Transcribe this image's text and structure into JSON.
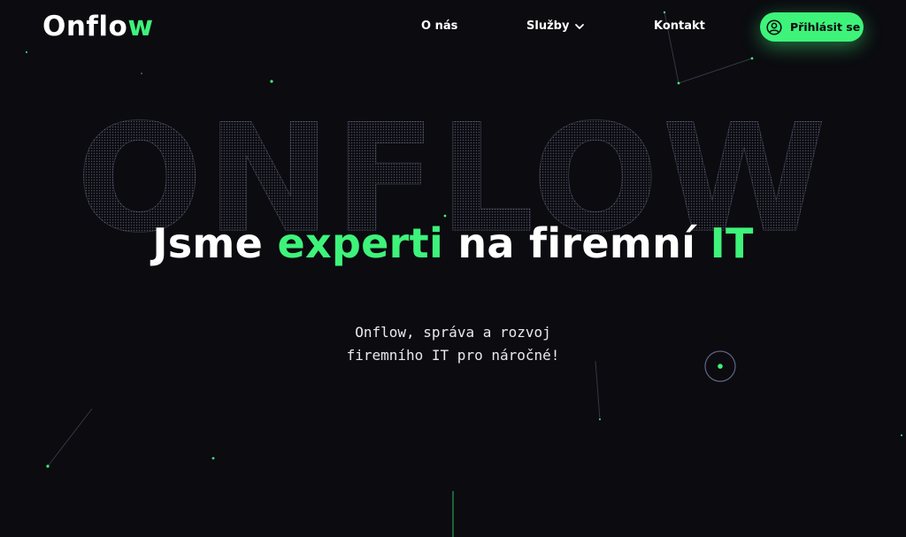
{
  "header": {
    "logo_main": "Onflo",
    "logo_accent": "w",
    "nav": {
      "about": "O nás",
      "services": "Služby",
      "contact": "Kontakt"
    },
    "login_label": "Přihlásit se"
  },
  "hero": {
    "background_word": "ONFLOW",
    "headline": {
      "part1": "Jsme ",
      "part2": "experti",
      "part3": " na firemní ",
      "part4": "IT"
    },
    "subtitle_line1": "Onflow, správa a rozvoj",
    "subtitle_line2": "firemního IT pro náročné!"
  },
  "colors": {
    "accent": "#3ef37a",
    "background": "#0b0b10",
    "text": "#ffffff",
    "login_button_text": "#0b0b10"
  },
  "icons": {
    "services_dropdown": "chevron-down-icon",
    "login": "user-circle-icon",
    "scroll_indicator": "scroll-dot-icon"
  }
}
